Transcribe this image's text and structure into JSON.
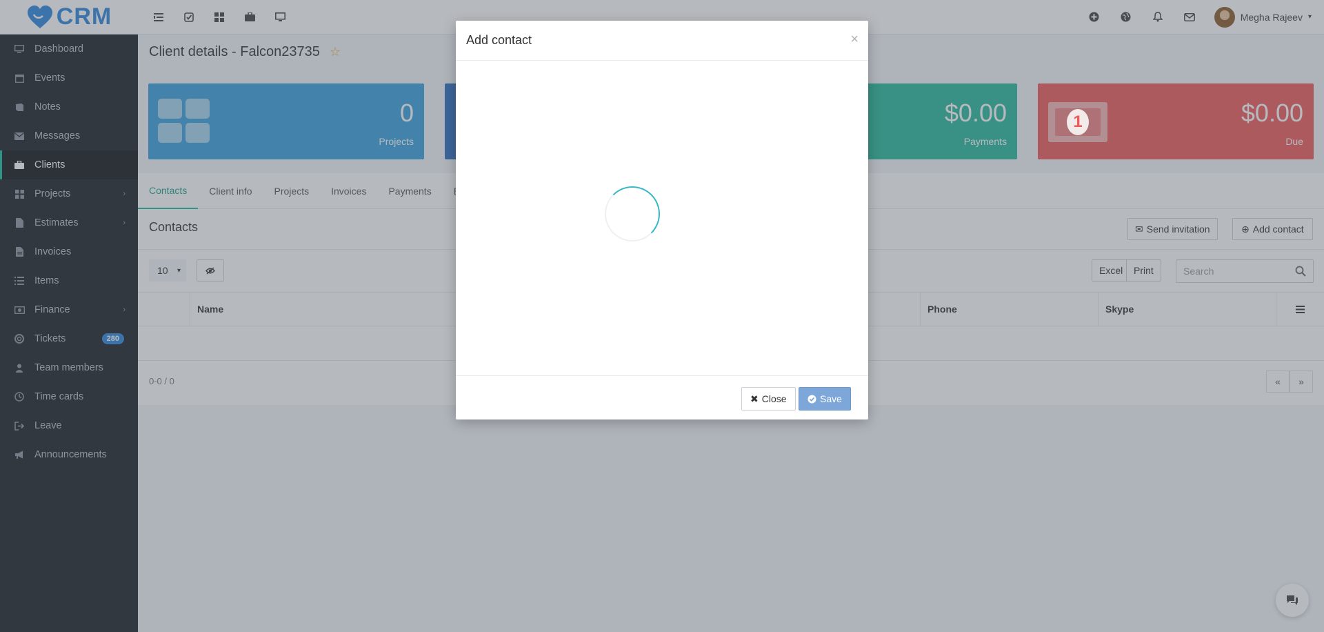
{
  "brand": {
    "name": "CRM"
  },
  "topbar": {
    "user_name": "Megha Rajeev"
  },
  "sidebar": {
    "items": [
      {
        "label": "Dashboard",
        "icon": "monitor-icon"
      },
      {
        "label": "Events",
        "icon": "calendar-icon"
      },
      {
        "label": "Notes",
        "icon": "book-icon"
      },
      {
        "label": "Messages",
        "icon": "envelope-icon"
      },
      {
        "label": "Clients",
        "icon": "briefcase-icon",
        "active": true
      },
      {
        "label": "Projects",
        "icon": "grid-icon",
        "expandable": true
      },
      {
        "label": "Estimates",
        "icon": "file-icon",
        "expandable": true
      },
      {
        "label": "Invoices",
        "icon": "file-text-icon"
      },
      {
        "label": "Items",
        "icon": "list-icon"
      },
      {
        "label": "Finance",
        "icon": "money-icon",
        "expandable": true
      },
      {
        "label": "Tickets",
        "icon": "lifebuoy-icon",
        "badge": "280"
      },
      {
        "label": "Team members",
        "icon": "user-icon"
      },
      {
        "label": "Time cards",
        "icon": "clock-icon"
      },
      {
        "label": "Leave",
        "icon": "sign-out-icon"
      },
      {
        "label": "Announcements",
        "icon": "bullhorn-icon"
      }
    ]
  },
  "page": {
    "title": "Client details - Falcon23735"
  },
  "stats": {
    "projects": {
      "value": "0",
      "label": "Projects"
    },
    "payments": {
      "value": "$0.00",
      "label": "Payments"
    },
    "due": {
      "value": "$0.00",
      "label": "Due"
    }
  },
  "tabs": [
    "Contacts",
    "Client info",
    "Projects",
    "Invoices",
    "Payments",
    "Es"
  ],
  "contacts": {
    "title": "Contacts",
    "send_invitation": "Send invitation",
    "add_contact": "Add contact",
    "page_size": "10",
    "excel": "Excel",
    "print": "Print",
    "search_placeholder": "Search",
    "columns": {
      "name": "Name",
      "phone": "Phone",
      "skype": "Skype"
    },
    "info": "0-0 / 0",
    "prev": "«",
    "next": "»"
  },
  "modal": {
    "title": "Add contact",
    "close_label": "Close",
    "save_label": "Save"
  },
  "colors": {
    "accent": "#1abc9c",
    "brand": "#2e86de",
    "projects_card": "#3aa0de",
    "payments_card": "#27b89c",
    "due_card": "#ee5b5b",
    "sidebar_bg": "#1c2026"
  }
}
